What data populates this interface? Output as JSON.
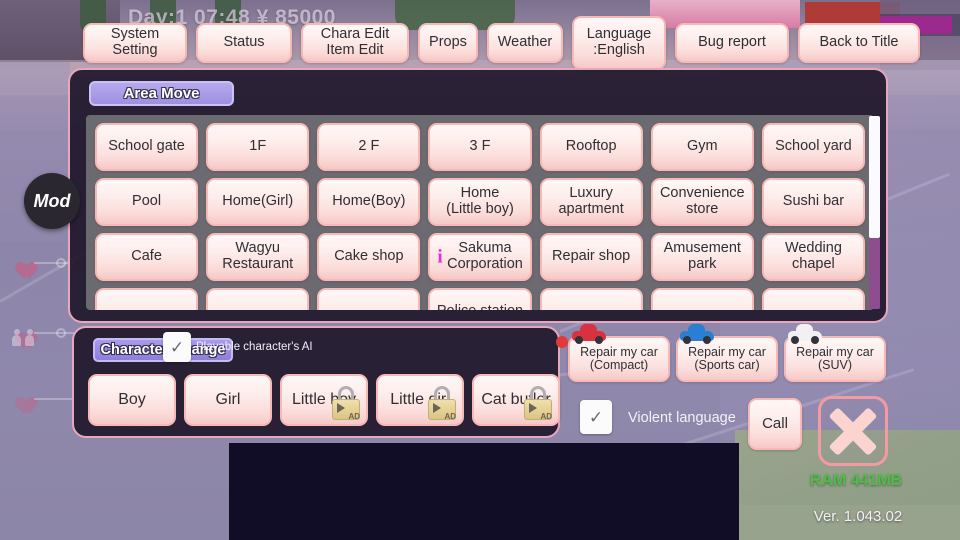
{
  "hud": {
    "day_readout": "Day:1  07:48  ¥ 85000",
    "mod_badge": "Mod"
  },
  "topmenu": {
    "items": [
      {
        "label": "System Setting",
        "name": "system-setting"
      },
      {
        "label": "Status",
        "name": "status"
      },
      {
        "label": "Chara Edit\nItem Edit",
        "name": "chara-item-edit"
      },
      {
        "label": "Props",
        "name": "props"
      },
      {
        "label": "Weather",
        "name": "weather"
      },
      {
        "label": "Language\n:English",
        "name": "language"
      },
      {
        "label": "Bug report",
        "name": "bug-report"
      },
      {
        "label": "Back to Title",
        "name": "back-to-title"
      }
    ]
  },
  "area_panel": {
    "tab_label": "Area Move",
    "areas": [
      "School gate",
      "1F",
      "2 F",
      "3 F",
      "Rooftop",
      "Gym",
      "School yard",
      "Pool",
      "Home(Girl)",
      "Home(Boy)",
      "Home\n(Little boy)",
      "Luxury\napartment",
      "Convenience\nstore",
      "Sushi bar",
      "Cafe",
      "Wagyu\nRestaurant",
      "Cake shop",
      "Sakuma\nCorporation",
      "Repair shop",
      "Amusement\npark",
      "Wedding\nchapel",
      "",
      "",
      "",
      "Police station",
      "",
      "",
      ""
    ],
    "info_marker_index": 17
  },
  "character_panel": {
    "tab_label": "Character Change",
    "ai_checkbox_label": "Playable character's AI",
    "ai_checkbox_checked": true,
    "characters": [
      {
        "label": "Boy",
        "locked": false
      },
      {
        "label": "Girl",
        "locked": false
      },
      {
        "label": "Little boy",
        "locked": true
      },
      {
        "label": "Little girl",
        "locked": true
      },
      {
        "label": "Cat butler",
        "locked": true
      }
    ],
    "lock_ad_label": "AD"
  },
  "repair": {
    "buttons": [
      {
        "label": "Repair my car\n(Compact)",
        "car_color": "#d8313f"
      },
      {
        "label": "Repair my car\n(Sports car)",
        "car_color": "#2a7fd4"
      },
      {
        "label": "Repair my car\n(SUV)",
        "car_color": "#f2f0f2"
      }
    ]
  },
  "bottom": {
    "violent_language_label": "Violent language",
    "violent_language_checked": true,
    "call_label": "Call",
    "ram_text": "RAM 441MB",
    "version_text": "Ver. 1.043.02"
  },
  "colors": {
    "button_border": "#f7b9b6",
    "tab_purple": "#9f90e0",
    "panel_bg": "#201830",
    "ram_green": "#4fbb48",
    "info_magenta": "#e52fd0",
    "progress_magenta": "#9c2a8e"
  }
}
